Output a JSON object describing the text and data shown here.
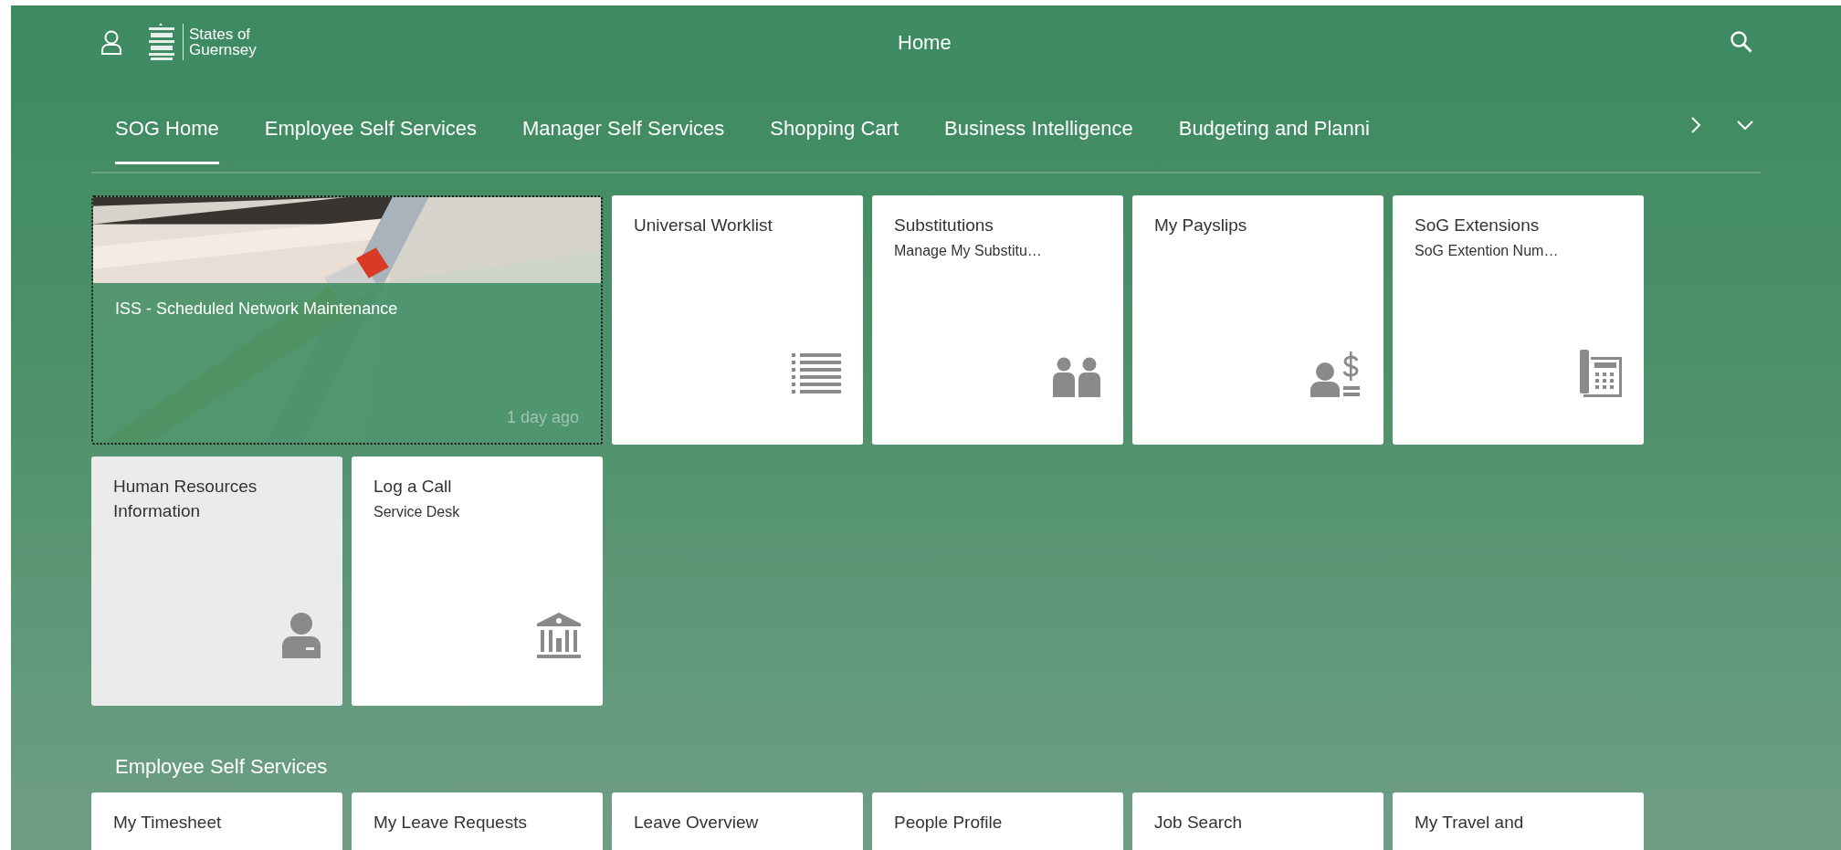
{
  "header": {
    "logo_text": [
      "States of",
      "Guernsey"
    ],
    "title": "Home"
  },
  "tabs": [
    {
      "label": "SOG Home",
      "selected": true
    },
    {
      "label": "Employee Self Services",
      "selected": false
    },
    {
      "label": "Manager Self Services",
      "selected": false
    },
    {
      "label": "Shopping Cart",
      "selected": false
    },
    {
      "label": "Business Intelligence",
      "selected": false
    },
    {
      "label": "Budgeting and Planni",
      "selected": false
    }
  ],
  "groups": [
    {
      "tiles": [
        {
          "kind": "news",
          "title": "ISS - Scheduled Network Maintenance",
          "time": "1 day ago",
          "focused": true
        },
        {
          "kind": "app",
          "title": "Universal Worklist",
          "highlighted": false
        },
        {
          "kind": "app",
          "title": "Substitutions",
          "subtitle": "Manage My Substitu…",
          "highlighted": false
        },
        {
          "kind": "app",
          "title": "My Payslips",
          "highlighted": false
        },
        {
          "kind": "app",
          "title": "SoG Extensions",
          "subtitle": "SoG Extention Num…",
          "highlighted": false
        },
        {
          "kind": "app",
          "title": "Human Resources Information",
          "highlighted": true
        },
        {
          "kind": "app",
          "title": "Log a Call",
          "subtitle": "Service Desk",
          "highlighted": false
        }
      ]
    },
    {
      "title": "Employee Self Services",
      "tiles": [
        {
          "kind": "app",
          "title": "My Timesheet",
          "highlighted": false
        },
        {
          "kind": "app",
          "title": "My Leave Requests",
          "highlighted": false
        },
        {
          "kind": "app",
          "title": "Leave Overview",
          "highlighted": false
        },
        {
          "kind": "app",
          "title": "People Profile",
          "highlighted": false
        },
        {
          "kind": "app",
          "title": "Job Search",
          "highlighted": false
        },
        {
          "kind": "app",
          "title": "My Travel and",
          "highlighted": false
        }
      ]
    }
  ]
}
